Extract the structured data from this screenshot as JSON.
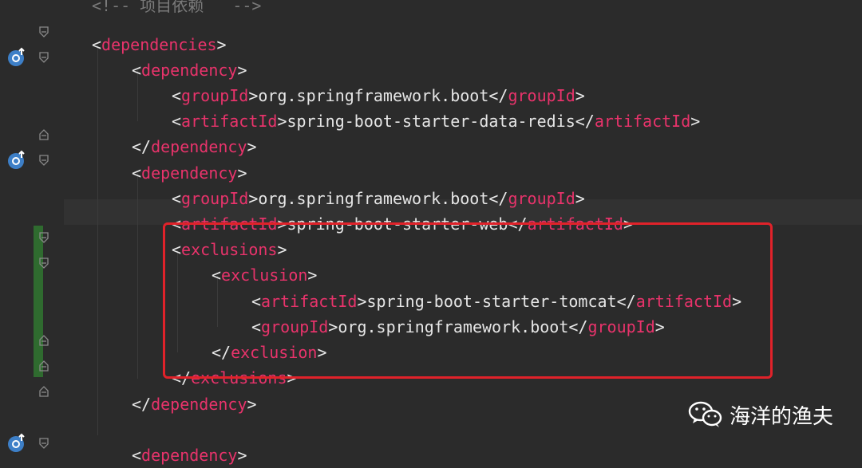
{
  "colors": {
    "background": "#2b2b2b",
    "tag": "#e8336b",
    "text": "#e6e6e6",
    "comment": "#7a7a7a",
    "highlight_box": "#e0222a",
    "vcs_added_bar": "#2f6b2f"
  },
  "code": {
    "comment_line": "<!-- 项目依赖   -->",
    "lines": [
      {
        "o": "<",
        "tag": "dependencies",
        "c": ">"
      },
      {
        "o": "<",
        "tag": "dependency",
        "c": ">"
      },
      {
        "o": "<",
        "tag": "groupId",
        "c": ">",
        "value": "org.springframework.boot",
        "o2": "</",
        "tag2": "groupId",
        "c2": ">"
      },
      {
        "o": "<",
        "tag": "artifactId",
        "c": ">",
        "value": "spring-boot-starter-data-redis",
        "o2": "</",
        "tag2": "artifactId",
        "c2": ">"
      },
      {
        "o": "</",
        "tag": "dependency",
        "c": ">"
      },
      {
        "o": "<",
        "tag": "dependency",
        "c": ">"
      },
      {
        "o": "<",
        "tag": "groupId",
        "c": ">",
        "value": "org.springframework.boot",
        "o2": "</",
        "tag2": "groupId",
        "c2": ">"
      },
      {
        "o": "<",
        "tag": "artifactId",
        "c": ">",
        "value": "spring-boot-starter-web",
        "o2": "</",
        "tag2": "artifactId",
        "c2": ">"
      },
      {
        "o": "<",
        "tag": "exclusions",
        "c": ">"
      },
      {
        "o": "<",
        "tag": "exclusion",
        "c": ">"
      },
      {
        "o": "<",
        "tag": "artifactId",
        "c": ">",
        "value": "spring-boot-starter-tomcat",
        "o2": "</",
        "tag2": "artifactId",
        "c2": ">"
      },
      {
        "o": "<",
        "tag": "groupId",
        "c": ">",
        "value": "org.springframework.boot",
        "o2": "</",
        "tag2": "groupId",
        "c2": ">"
      },
      {
        "o": "</",
        "tag": "exclusion",
        "c": ">"
      },
      {
        "o": "</",
        "tag": "exclusions",
        "c": ">"
      },
      {
        "o": "</",
        "tag": "dependency",
        "c": ">"
      },
      {
        "o": "<",
        "tag": "dependency",
        "c": ">"
      }
    ]
  },
  "watermark": {
    "icon": "wechat-icon",
    "text": "海洋的渔夫"
  },
  "gutter": {
    "implement_icon": "implemented-marker-icon",
    "fold_icon": "fold-marker-icon"
  }
}
